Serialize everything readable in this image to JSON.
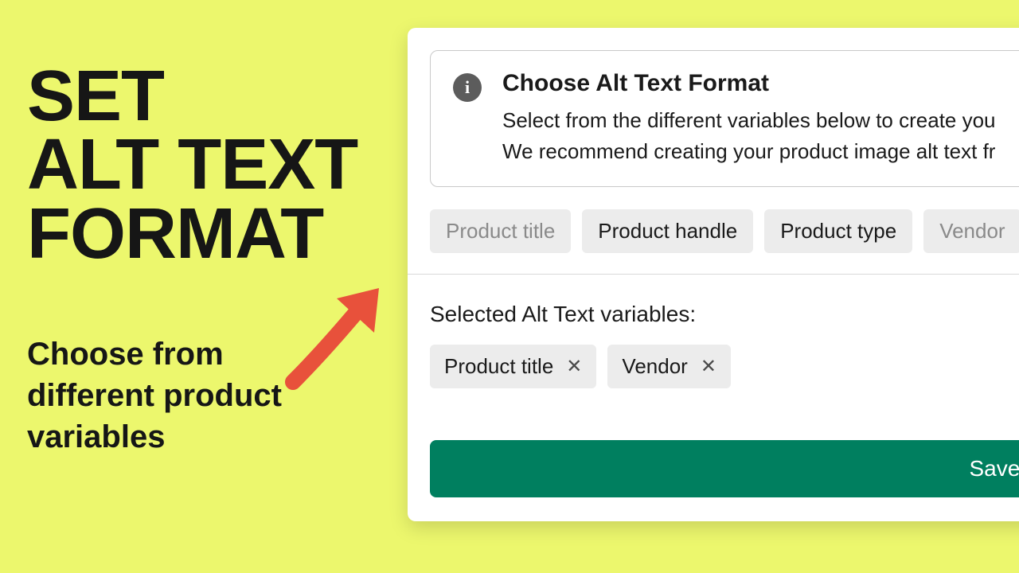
{
  "promo": {
    "headline_l1": "SET",
    "headline_l2": "ALT TEXT",
    "headline_l3": "FORMAT",
    "subhead": "Choose from different product variables"
  },
  "panel": {
    "info": {
      "title": "Choose Alt Text Format",
      "line1": "Select from the different variables below to create you",
      "line2": "We recommend creating your product image alt text fr"
    },
    "chips": [
      {
        "label": "Product title",
        "muted": true
      },
      {
        "label": "Product handle",
        "muted": false
      },
      {
        "label": "Product type",
        "muted": false
      },
      {
        "label": "Vendor",
        "muted": true
      }
    ],
    "selected_label": "Selected Alt Text variables:",
    "selected": [
      {
        "label": "Product title"
      },
      {
        "label": "Vendor"
      }
    ],
    "save_label": "Save & preview"
  },
  "colors": {
    "bg": "#ecf76d",
    "accent": "#007f5f",
    "arrow": "#e8513b"
  }
}
